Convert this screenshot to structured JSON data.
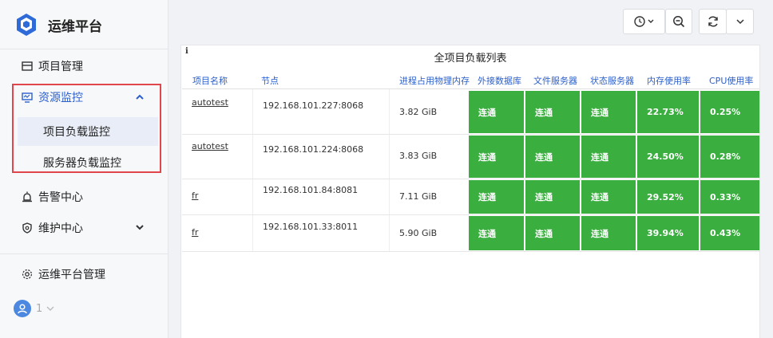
{
  "brand": {
    "title": "运维平台"
  },
  "sidebar": {
    "items": [
      {
        "label": "项目管理",
        "icon": "list-icon"
      },
      {
        "label": "资源监控",
        "icon": "monitor-icon",
        "expanded": true,
        "children": [
          {
            "label": "项目负载监控",
            "active": true
          },
          {
            "label": "服务器负载监控",
            "active": false
          }
        ]
      },
      {
        "label": "告警中心",
        "icon": "alarm-icon"
      },
      {
        "label": "维护中心",
        "icon": "shield-icon",
        "expanded": false
      },
      {
        "label": "运维平台管理",
        "icon": "gear-icon"
      }
    ],
    "user": {
      "count": "1"
    }
  },
  "toolbar": {
    "buttons": [
      "history-icon",
      "zoom-out-icon",
      "refresh-icon",
      "chevron-down-icon"
    ]
  },
  "panel": {
    "info": "i",
    "title": "全项目负载列表",
    "columns": [
      "项目名称",
      "节点",
      "进程占用物理内存",
      "外接数据库",
      "文件服务器",
      "状态服务器",
      "内存使用率",
      "CPU使用率"
    ],
    "rows": [
      {
        "name": "autotest",
        "node": "192.168.101.227:8068",
        "mem": "3.82 GiB",
        "db": "连通",
        "file": "连通",
        "state": "连通",
        "mem_rate": "22.73%",
        "cpu_rate": "0.25%"
      },
      {
        "name": "autotest",
        "node": "192.168.101.224:8068",
        "mem": "3.83 GiB",
        "db": "连通",
        "file": "连通",
        "state": "连通",
        "mem_rate": "24.50%",
        "cpu_rate": "0.28%"
      },
      {
        "name": "fr",
        "node": "192.168.101.84:8081",
        "mem": "7.11 GiB",
        "db": "连通",
        "file": "连通",
        "state": "连通",
        "mem_rate": "29.52%",
        "cpu_rate": "0.33%"
      },
      {
        "name": "fr",
        "node": "192.168.101.33:8011",
        "mem": "5.90 GiB",
        "db": "连通",
        "file": "连通",
        "state": "连通",
        "mem_rate": "39.94%",
        "cpu_rate": "0.43%"
      }
    ]
  },
  "colors": {
    "accent": "#2b5fcc",
    "ok_green": "#3aae3f",
    "highlight": "#e0464c"
  }
}
